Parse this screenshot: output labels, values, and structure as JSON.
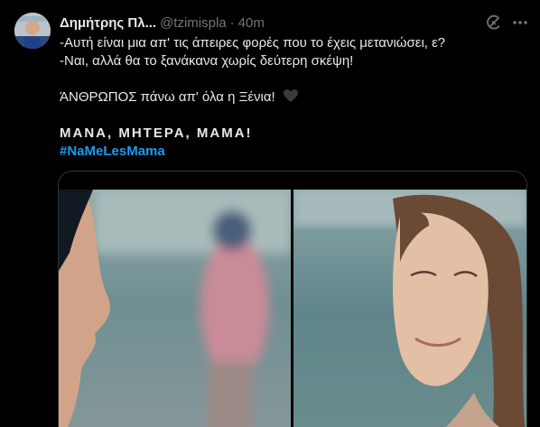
{
  "tweet": {
    "display_name": "Δημήτρης Πλ...",
    "handle": "@tzimispla",
    "separator": "·",
    "time": "40m",
    "lines": [
      "-Αυτή είναι μια απ' τις άπειρες φορές που το έχεις μετανιώσει, ε?",
      "-Ναι, αλλά θα το ξανάκανα χωρίς δεύτερη σκέψη!",
      "ΆΝΘΡΩΠΟΣ πάνω απ' όλα η Ξένια!",
      "ΜΑΝΑ, ΜΗΤΕΡΑ, ΜΑΜΑ!",
      "#NaMeLesMama"
    ]
  },
  "icons": {
    "avatar": "avatar-photo",
    "grok": "grok-icon",
    "more": "more-dots-icon",
    "heart": "black-heart-icon"
  },
  "colors": {
    "background": "#000000",
    "text": "#e7e9ea",
    "muted": "#71767b",
    "link": "#1d9bf0",
    "border": "#2f3336"
  },
  "media": {
    "left_image": "woman-profile-beach-with-blurred-figure-in-pink",
    "right_image": "young-woman-smiling-tearfully"
  }
}
